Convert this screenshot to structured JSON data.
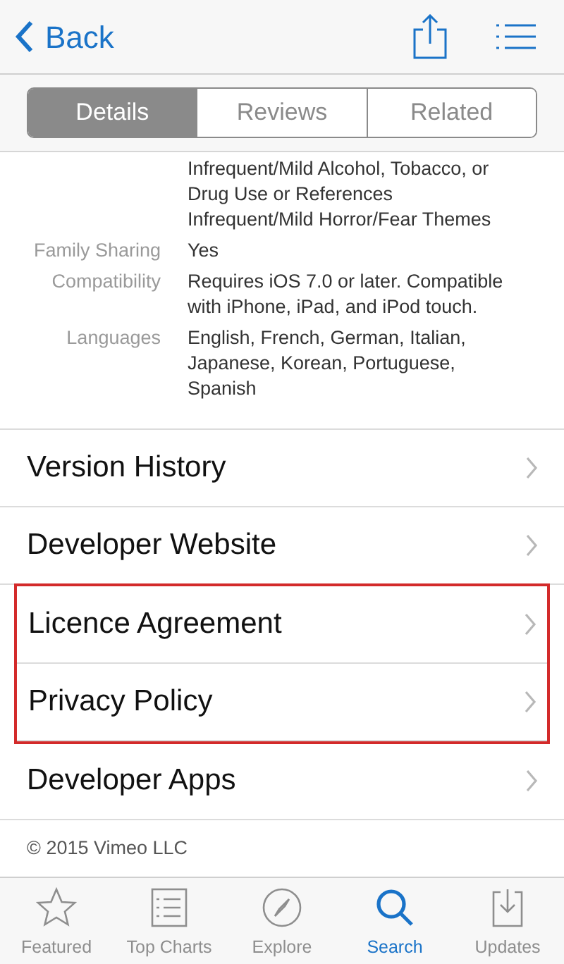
{
  "nav": {
    "back_label": "Back"
  },
  "segments": [
    {
      "label": "Details",
      "selected": true
    },
    {
      "label": "Reviews",
      "selected": false
    },
    {
      "label": "Related",
      "selected": false
    }
  ],
  "info": [
    {
      "lines": [
        "Infrequent/Mild Alcohol, Tobacco, or",
        "Drug Use or References",
        "Infrequent/Mild Horror/Fear Themes"
      ]
    },
    {
      "label": "Family Sharing",
      "lines": [
        "Yes"
      ]
    },
    {
      "label": "Compatibility",
      "lines": [
        "Requires iOS 7.0 or later. Compatible",
        "with iPhone, iPad, and iPod touch."
      ]
    },
    {
      "label": "Languages",
      "lines": [
        "English, French, German, Italian,",
        "Japanese, Korean, Portuguese,",
        "Spanish"
      ]
    }
  ],
  "links": [
    {
      "label": "Version History",
      "highlighted": false
    },
    {
      "label": "Developer Website",
      "highlighted": false
    },
    {
      "label": "Licence Agreement",
      "highlighted": true
    },
    {
      "label": "Privacy Policy",
      "highlighted": true
    },
    {
      "label": "Developer Apps",
      "highlighted": false
    }
  ],
  "copyright": "© 2015 Vimeo LLC",
  "tab_bar": [
    {
      "label": "Featured",
      "kind": "star",
      "selected": false
    },
    {
      "label": "Top Charts",
      "kind": "list",
      "selected": false
    },
    {
      "label": "Explore",
      "kind": "compass",
      "selected": false
    },
    {
      "label": "Search",
      "kind": "search",
      "selected": true
    },
    {
      "label": "Updates",
      "kind": "download",
      "selected": false
    }
  ]
}
